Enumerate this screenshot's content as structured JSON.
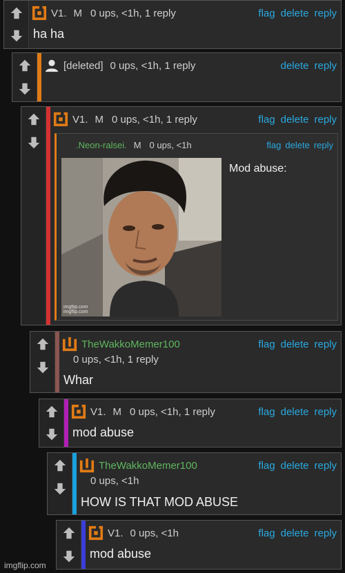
{
  "colors": {
    "link": "#2aa9e0",
    "green_name": "#5fb65f",
    "stripe_orange": "#e07b16",
    "stripe_red": "#d63131",
    "stripe_brown": "#8a5552",
    "stripe_magenta": "#b01fb5",
    "stripe_cyan": "#1aa0dd",
    "stripe_blue": "#3a3dd8"
  },
  "actions": {
    "flag": "flag",
    "delete": "delete",
    "reply": "reply"
  },
  "comments": [
    {
      "user": "V1.",
      "mod": "M",
      "meta": "0 ups, <1h, 1 reply",
      "body": "ha ha",
      "avatar_icon": "orange-square-logo-icon"
    },
    {
      "user": "[deleted]",
      "meta": "0 ups, <1h, 1 reply",
      "body": "",
      "avatar_icon": "person-icon"
    },
    {
      "user": "V1.",
      "mod": "M",
      "meta": "0 ups, <1h, 1 reply",
      "body": "",
      "avatar_icon": "orange-square-logo-icon",
      "quote": {
        "user": ".Neon-ralsei.",
        "mod": "M",
        "meta": "0 ups, <1h",
        "text": "Mod abuse:",
        "image_watermark_1": "imgflip.com",
        "image_watermark_2": "imgflip.com"
      }
    },
    {
      "user": "TheWakkoMemer100",
      "meta": "0 ups, <1h, 1 reply",
      "body": "Whar",
      "avatar_icon": "wakko-logo-icon"
    },
    {
      "user": "V1.",
      "mod": "M",
      "meta": "0 ups, <1h, 1 reply",
      "body": "mod abuse",
      "avatar_icon": "orange-square-logo-icon"
    },
    {
      "user": "TheWakkoMemer100",
      "meta": "0 ups, <1h",
      "body": "HOW IS THAT MOD ABUSE",
      "avatar_icon": "wakko-logo-icon"
    },
    {
      "user": "V1.",
      "meta": "0 ups, <1h",
      "body": "mod abuse",
      "avatar_icon": "orange-square-logo-icon"
    }
  ],
  "footer_watermark": "imgflip.com"
}
